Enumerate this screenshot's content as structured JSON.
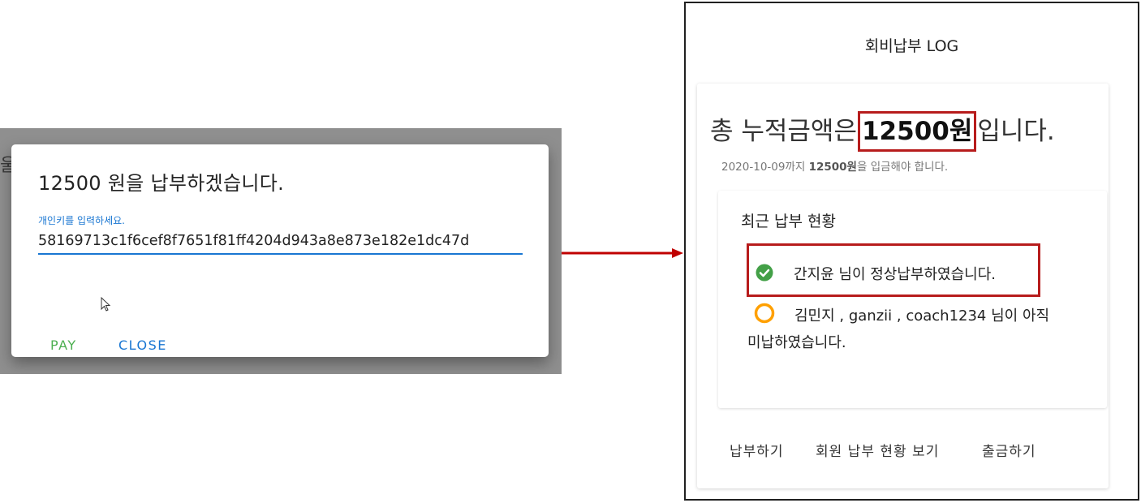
{
  "payment_dialog": {
    "background_fragment": "울",
    "title": "12500 원을 납부하겠습니다.",
    "field_label": "개인키를 입력하세요.",
    "key_value": "58169713c1f6cef8f7651f81ff4204d943a8e873e182e1dc47d",
    "pay_label": "PAY",
    "close_label": "CLOSE"
  },
  "log_panel": {
    "title": "회비납부 LOG",
    "total_prefix": "총 누적금액은",
    "total_amount": "12500원",
    "total_suffix": "입니다.",
    "deadline_date": "2020-10-09까지",
    "deadline_amount": "12500원",
    "deadline_suffix": "을 입금해야 합니다.",
    "recent_title": "최근 납부 현황",
    "paid_message": "간지윤 님이 정상납부하였습니다.",
    "unpaid_message": "김민지 , ganzii , coach1234 님이 아직 미납하였습니다.",
    "actions": [
      "납부하기",
      "회원 납부 현황 보기",
      "출금하기"
    ]
  },
  "colors": {
    "highlight_border": "#b71c1c",
    "arrow": "#c00000",
    "paid_icon": "#43a047",
    "unpaid_icon": "#ffa000",
    "primary": "#1976d2",
    "pay_green": "#4caf50"
  },
  "icons": [
    "cursor-icon",
    "check-circle-icon",
    "pending-ring-icon",
    "arrow-right-icon"
  ]
}
